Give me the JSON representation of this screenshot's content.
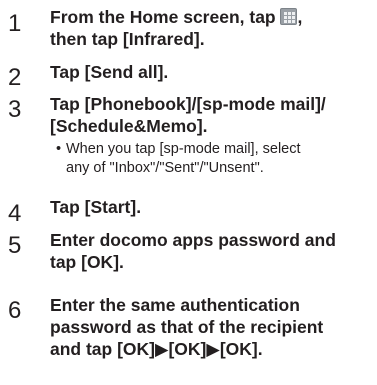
{
  "steps": [
    {
      "number": "1",
      "line1_before_icon": "From the Home screen, tap ",
      "line1_after_icon": ",",
      "line2": "then tap [Infrared].",
      "icon": "apps-menu-icon"
    },
    {
      "number": "2",
      "line1": "Tap [Send all]."
    },
    {
      "number": "3",
      "line1": "Tap [Phonebook]/[sp-mode mail]/",
      "line2": "[Schedule&Memo].",
      "note": {
        "bullet": "•",
        "line1": "When you tap [sp-mode mail], select",
        "line2": "any of \"Inbox\"/\"Sent\"/\"Unsent\"."
      }
    },
    {
      "number": "4",
      "line1": "Tap [Start]."
    },
    {
      "number": "5",
      "line1": "Enter docomo apps password and",
      "line2": "tap [OK]."
    },
    {
      "number": "6",
      "line1": "Enter the same authentication",
      "line2": "password as that of the recipient",
      "line3": "and tap [OK]▶[OK]▶[OK]."
    }
  ]
}
